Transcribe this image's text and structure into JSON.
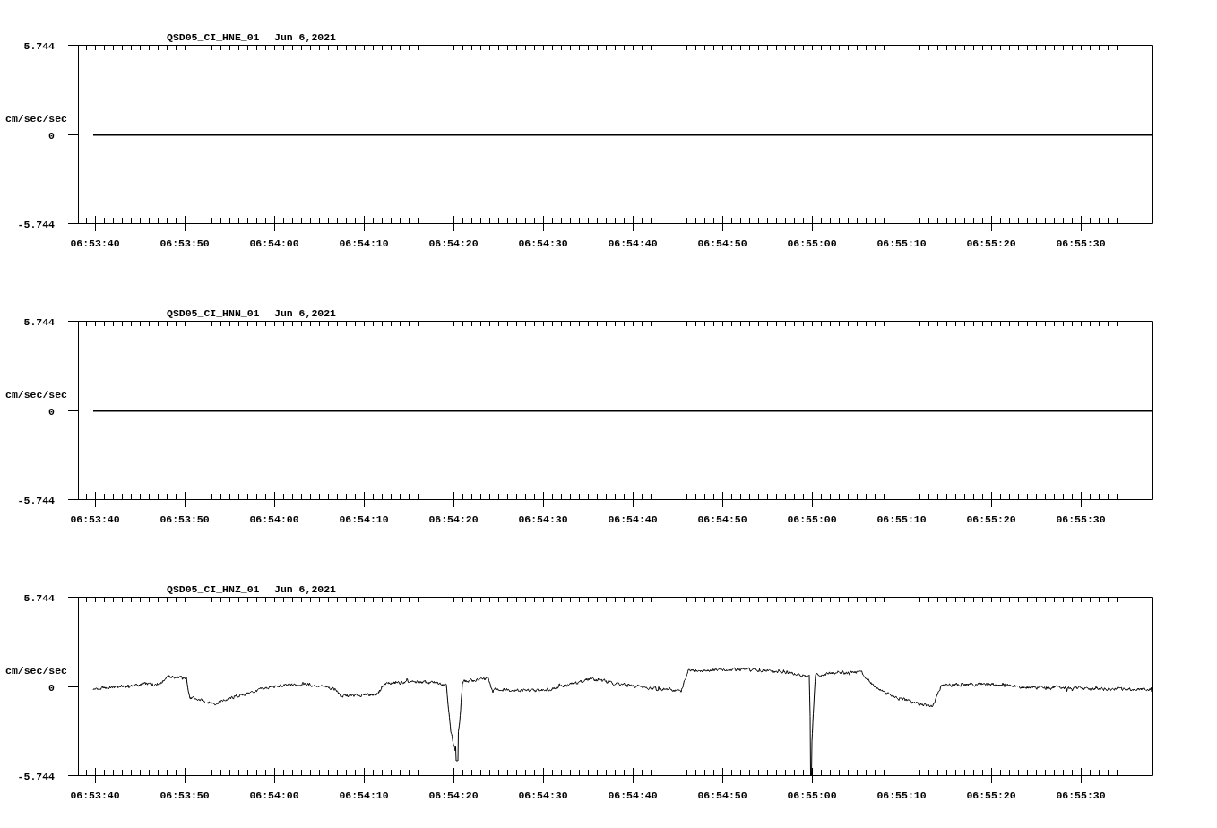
{
  "traces": [
    {
      "station": "QSD05_CI_HNE_01",
      "date": "Jun 6,2021",
      "units": "cm/sec/sec",
      "y_ticks": [
        "5.744",
        "0",
        "-5.744"
      ],
      "kind": "flat",
      "time_ticks": [
        "06:53:40",
        "06:53:50",
        "06:54:00",
        "06:54:10",
        "06:54:20",
        "06:54:30",
        "06:54:40",
        "06:54:50",
        "06:55:00",
        "06:55:10",
        "06:55:20",
        "06:55:30"
      ]
    },
    {
      "station": "QSD05_CI_HNN_01",
      "date": "Jun 6,2021",
      "units": "cm/sec/sec",
      "y_ticks": [
        "5.744",
        "0",
        "-5.744"
      ],
      "kind": "flat",
      "time_ticks": [
        "06:53:40",
        "06:53:50",
        "06:54:00",
        "06:54:10",
        "06:54:20",
        "06:54:30",
        "06:54:40",
        "06:54:50",
        "06:55:00",
        "06:55:10",
        "06:55:20",
        "06:55:30"
      ]
    },
    {
      "station": "QSD05_CI_HNZ_01",
      "date": "Jun 6,2021",
      "units": "cm/sec/sec",
      "y_ticks": [
        "5.744",
        "0",
        "-5.744"
      ],
      "kind": "waveform",
      "time_ticks": [
        "06:53:40",
        "06:53:50",
        "06:54:00",
        "06:54:10",
        "06:54:20",
        "06:54:30",
        "06:54:40",
        "06:54:50",
        "06:55:00",
        "06:55:10",
        "06:55:20",
        "06:55:30"
      ]
    }
  ]
}
